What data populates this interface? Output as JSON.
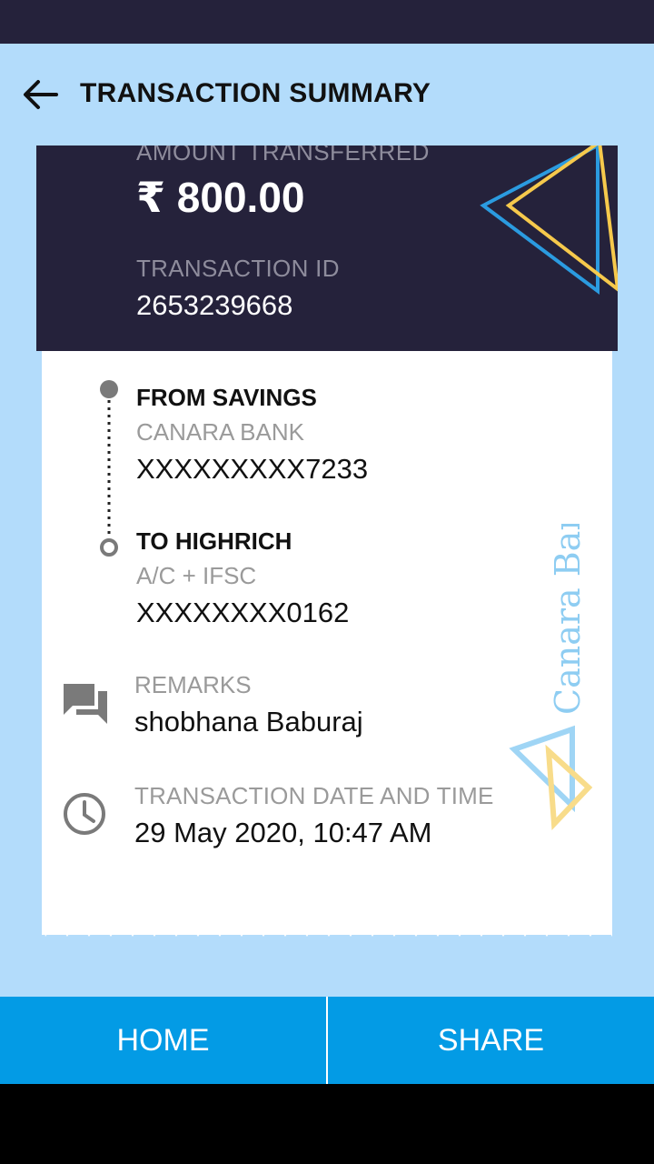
{
  "header": {
    "title": "TRANSACTION SUMMARY",
    "back_icon": "arrow-left-icon"
  },
  "summary": {
    "amount_label": "AMOUNT TRANSFERRED",
    "amount_value": "₹ 800.00",
    "txn_id_label": "TRANSACTION ID",
    "txn_id_value": "2653239668"
  },
  "from": {
    "title": "FROM SAVINGS",
    "bank": "CANARA BANK",
    "account": "XXXXXXXXX7233"
  },
  "to": {
    "title": "TO HIGHRICH",
    "subtitle": "A/C + IFSC",
    "account": "XXXXXXXX0162"
  },
  "remarks": {
    "label": "REMARKS",
    "value": "shobhana Baburaj",
    "icon": "chat-icon"
  },
  "date_time": {
    "label": "TRANSACTION DATE AND TIME",
    "value": "29 May 2020, 10:47 AM",
    "icon": "clock-icon"
  },
  "watermark": {
    "text": "Canara Bank"
  },
  "buttons": {
    "home": "HOME",
    "share": "SHARE"
  },
  "colors": {
    "background": "#b3dcfb",
    "dark": "#25223b",
    "accent_blue": "#039be5",
    "triangle_blue": "#2b9be0",
    "triangle_yellow": "#f6c94c"
  }
}
